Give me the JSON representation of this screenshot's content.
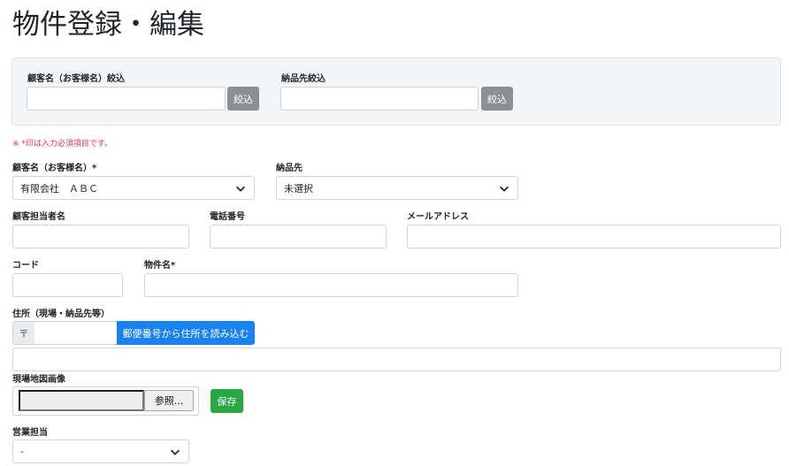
{
  "page": {
    "title": "物件登録・編集"
  },
  "filters": {
    "customer_label": "顧客名（お客様名）絞込",
    "customer_value": "",
    "customer_button": "絞込",
    "delivery_label": "納品先絞込",
    "delivery_value": "",
    "delivery_button": "絞込"
  },
  "note": "※ *印は入力必須項目です。",
  "form": {
    "customer_label": "顧客名（お客様名）*",
    "customer_selected": "有限会社　ＡＢＣ",
    "delivery_label": "納品先",
    "delivery_selected": "未選択",
    "contact_label": "顧客担当者名",
    "contact_value": "",
    "phone_label": "電話番号",
    "phone_value": "",
    "email_label": "メールアドレス",
    "email_value": "",
    "code_label": "コード",
    "code_value": "",
    "property_label": "物件名*",
    "property_value": "",
    "address_label": "住所（現場・納品先等）",
    "zip_prefix": "〒",
    "zip_value": "",
    "zip_button": "郵便番号から住所を読み込む",
    "address_value": "",
    "map_label": "現場地図画像",
    "browse_button": "参照...",
    "save_button": "保存",
    "sales_label": "営業担当",
    "sales_selected": "-"
  },
  "icons": {
    "select": "chevron-down-icon"
  },
  "colors": {
    "required_note": "#dc3545",
    "filter_button": "#8b9096",
    "zip_button": "#1a82f0",
    "save_button": "#28a745"
  }
}
